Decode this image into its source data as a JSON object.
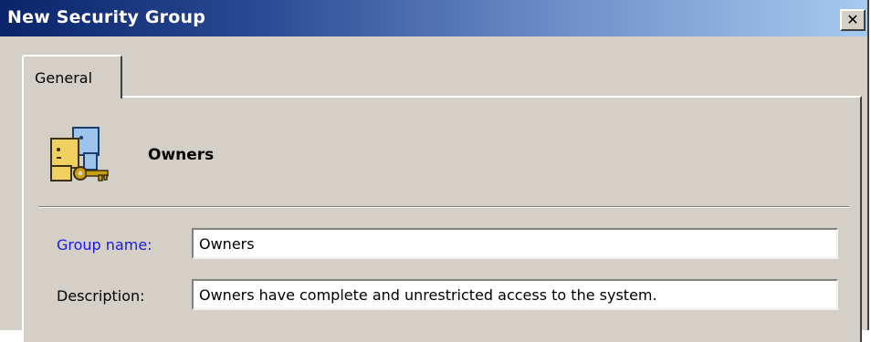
{
  "window": {
    "title": "New Security Group",
    "close_label": "✕"
  },
  "tabs": [
    {
      "label": "General",
      "selected": true
    }
  ],
  "header": {
    "icon": "security-group-key-icon",
    "name": "Owners"
  },
  "form": {
    "group_name": {
      "label": "Group name:",
      "value": "Owners"
    },
    "description": {
      "label": "Description:",
      "value": "Owners have complete and unrestricted access to the system."
    }
  },
  "colors": {
    "titlebar_start": "#0a246a",
    "titlebar_end": "#a6caf0",
    "dialog_face": "#d4d0c8",
    "active_label": "#1a1ae6"
  }
}
